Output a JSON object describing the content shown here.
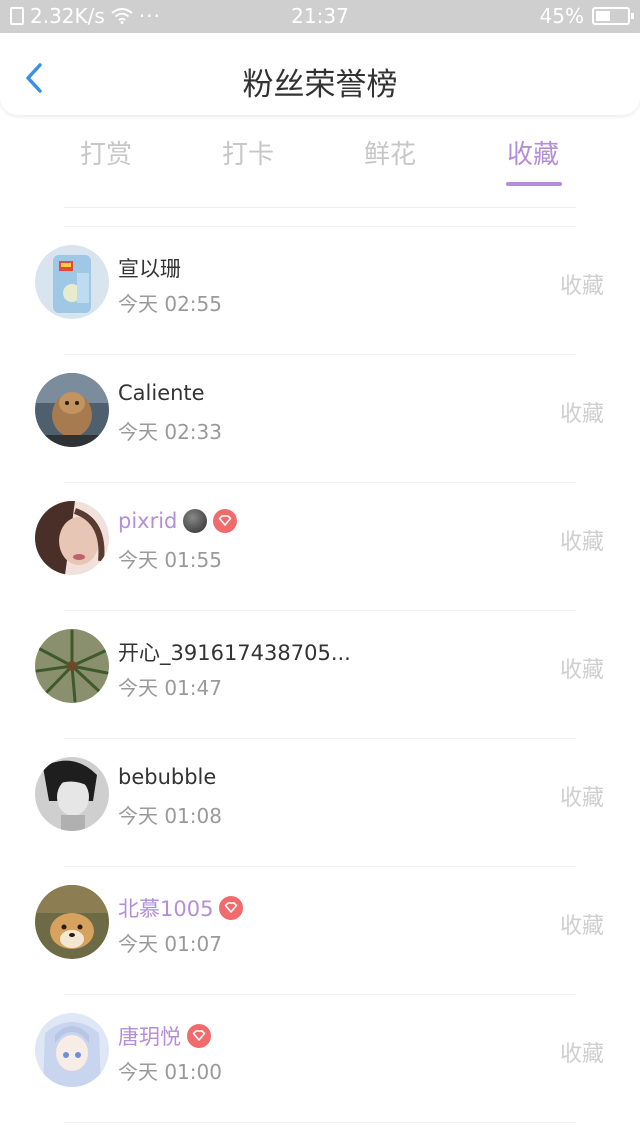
{
  "status_bar": {
    "net_speed": "2.32K/s",
    "dots": "···",
    "time": "21:37",
    "battery": "45%"
  },
  "header": {
    "title": "粉丝荣誉榜"
  },
  "tabs": [
    {
      "label": "打赏"
    },
    {
      "label": "打卡"
    },
    {
      "label": "鲜花"
    },
    {
      "label": "收藏"
    }
  ],
  "active_tab": "收藏",
  "colors": {
    "accent": "#b48ed8",
    "badge": "#f06b6b",
    "muted": "#cfcfcf"
  },
  "list": [
    {
      "name": "宣以珊",
      "time": "今天 02:55",
      "action": "收藏",
      "vip": false
    },
    {
      "name": "Caliente",
      "time": "今天 02:33",
      "action": "收藏",
      "vip": false
    },
    {
      "name": "pixrid",
      "time": "今天 01:55",
      "action": "收藏",
      "vip": true,
      "emoji": "moon-face-emoji"
    },
    {
      "name": "开心_391617438705...",
      "time": "今天 01:47",
      "action": "收藏",
      "vip": false
    },
    {
      "name": "bebubble",
      "time": "今天 01:08",
      "action": "收藏",
      "vip": false
    },
    {
      "name": "北慕1005",
      "time": "今天 01:07",
      "action": "收藏",
      "vip": true
    },
    {
      "name": "唐玥悦",
      "time": "今天 01:00",
      "action": "收藏",
      "vip": true
    }
  ]
}
